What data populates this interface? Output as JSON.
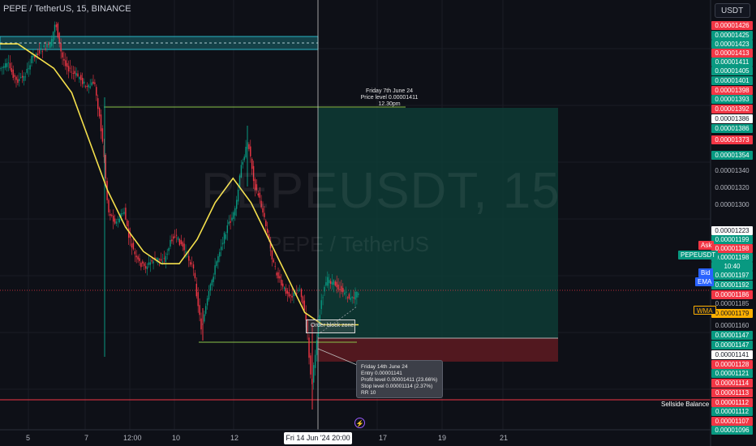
{
  "header": {
    "title": "PEPE / TetherUS, 15, BINANCE",
    "currency": "USDT"
  },
  "watermark": {
    "symbol": "PEPEUSDT, 15",
    "name": "PEPE / TetherUS"
  },
  "annotations": {
    "target_note": {
      "line1": "Friday 7th June 24",
      "line2": "Price level 0.00001411",
      "line3": "12.30pm"
    },
    "order_block": "Order block zone",
    "trade_note": {
      "line1": "Friday 14th June 24",
      "line2": "Entry 0.00001141",
      "line3": "Profit level 0.00001411 (23.66%)",
      "line4": "Stop level 0.00001114 (2.37%)",
      "line5": "RR 10"
    },
    "sellside": "Sellside Balance"
  },
  "price_scale": [
    {
      "text": "0.00001426",
      "style": "red"
    },
    {
      "text": "0.00001425",
      "style": "green"
    },
    {
      "text": "0.00001423",
      "style": "green"
    },
    {
      "text": "0.00001413",
      "style": "red"
    },
    {
      "text": "0.00001411",
      "style": "green"
    },
    {
      "text": "0.00001405",
      "style": "green"
    },
    {
      "text": "0.00001401",
      "style": "green"
    },
    {
      "text": "0.00001398",
      "style": "red"
    },
    {
      "text": "0.00001393",
      "style": "green"
    },
    {
      "text": "0.00001392",
      "style": "red"
    },
    {
      "text": "0.00001386",
      "style": "white"
    },
    {
      "text": "0.00001386",
      "style": "green"
    },
    {
      "text": "0.00001373",
      "style": "red"
    },
    {
      "text": "0.00001354",
      "style": "green"
    },
    {
      "text": "0.00001340",
      "style": "plain"
    },
    {
      "text": "0.00001320",
      "style": "plain"
    },
    {
      "text": "0.00001300",
      "style": "plain"
    },
    {
      "text": "0.00001223",
      "style": "white"
    },
    {
      "text": "0.00001199",
      "style": "green"
    },
    {
      "text": "0.00001198",
      "style": "red"
    },
    {
      "text": "0.00001198",
      "style": "green"
    },
    {
      "text": "10:40",
      "style": "green"
    },
    {
      "text": "0.00001197",
      "style": "green"
    },
    {
      "text": "0.00001192",
      "style": "green"
    },
    {
      "text": "0.00001186",
      "style": "red"
    },
    {
      "text": "0.00001185",
      "style": "plain"
    },
    {
      "text": "0.00001179",
      "style": "orange"
    },
    {
      "text": "0.00001160",
      "style": "plain"
    },
    {
      "text": "0.00001147",
      "style": "green"
    },
    {
      "text": "0.00001147",
      "style": "green"
    },
    {
      "text": "0.00001141",
      "style": "white"
    },
    {
      "text": "0.00001128",
      "style": "red"
    },
    {
      "text": "0.00001121",
      "style": "green"
    },
    {
      "text": "0.00001114",
      "style": "red"
    },
    {
      "text": "0.00001113",
      "style": "red"
    },
    {
      "text": "0.00001112",
      "style": "red"
    },
    {
      "text": "0.00001112",
      "style": "green"
    },
    {
      "text": "0.00001107",
      "style": "red"
    },
    {
      "text": "0.00001096",
      "style": "green"
    }
  ],
  "side_labels": {
    "ask": "Ask",
    "symbol": "PEPEUSDT",
    "bid": "Bid",
    "ema": "EMA",
    "wma": "WMA"
  },
  "time_axis": {
    "labels": [
      "5",
      "7",
      "12:00",
      "10",
      "12",
      "17",
      "19",
      "21"
    ],
    "selected": "Fri 14 Jun '24   20:00"
  },
  "colors": {
    "background": "#0e1017",
    "up": "#089981",
    "down": "#f23645",
    "ema": "#f5e04c",
    "profit_zone": "#0d3b35",
    "loss_zone": "#5a1a20",
    "resistance_zone": "#17525a",
    "sellside_line": "#f23645",
    "target_line": "#8bc34a"
  },
  "icons": {
    "bolt": "lightning-icon"
  },
  "chart_data": {
    "type": "candlestick",
    "symbol": "PEPEUSDT",
    "interval": "15",
    "ylim": [
      1.096e-05,
      1.426e-05
    ],
    "key_levels": {
      "target": 1.411e-05,
      "entry": 1.141e-05,
      "stop": 1.114e-05,
      "sellside_balance": 1.112e-05
    },
    "series": [
      {
        "name": "EMA",
        "values": [
          1.41e-05,
          1.41e-05,
          1.4e-05,
          1.39e-05,
          1.37e-05,
          1.33e-05,
          1.29e-05,
          1.26e-05,
          1.24e-05,
          1.23e-05,
          1.23e-05,
          1.25e-05,
          1.28e-05,
          1.3e-05,
          1.28e-05,
          1.25e-05,
          1.22e-05,
          1.19e-05,
          1.18e-05,
          1.18e-05,
          1.18e-05
        ]
      }
    ]
  }
}
